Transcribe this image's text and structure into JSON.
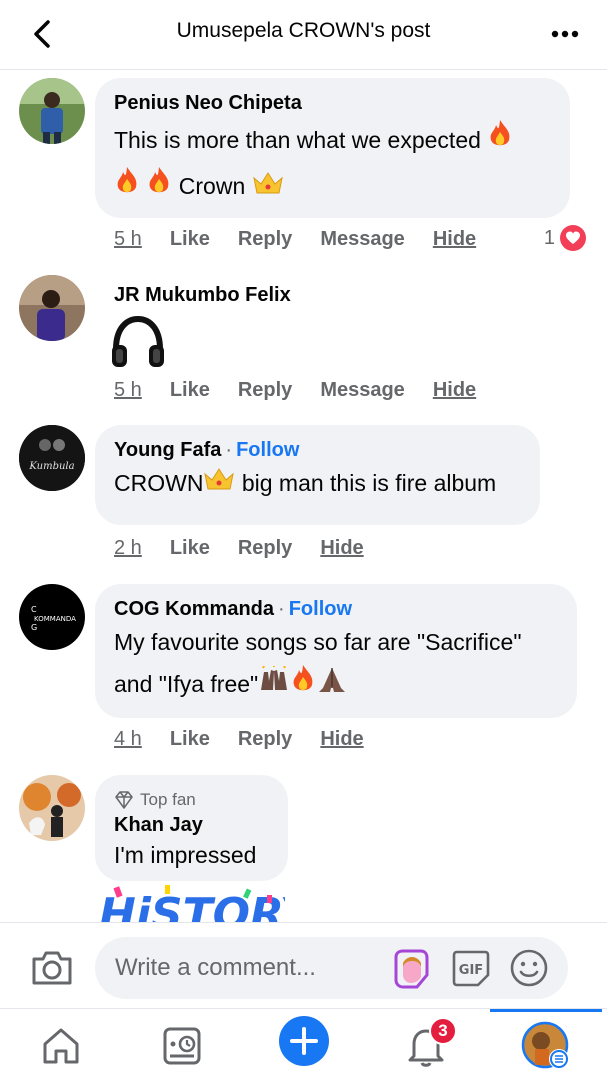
{
  "header": {
    "title": "Umusepela CROWN's post"
  },
  "comments": [
    {
      "author": "Penius Neo Chipeta",
      "text_line1": "This is more than what we expected",
      "text_line2": "Crown",
      "time": "5 h",
      "like": "Like",
      "reply": "Reply",
      "message": "Message",
      "hide": "Hide",
      "reaction_count": "1"
    },
    {
      "author": "JR Mukumbo Felix",
      "time": "5 h",
      "like": "Like",
      "reply": "Reply",
      "message": "Message",
      "hide": "Hide"
    },
    {
      "author": "Young Fafa",
      "follow": "Follow",
      "text_a": "CROWN",
      "text_b": " big man this is fire album",
      "time": "2 h",
      "like": "Like",
      "reply": "Reply",
      "hide": "Hide",
      "avatar_text": "Kumbula"
    },
    {
      "author": "COG Kommanda",
      "follow": "Follow",
      "text_line1": "My favourite songs so far are \"Sacrifice\"",
      "text_line2": "and \"Ifya free\"",
      "time": "4 h",
      "like": "Like",
      "reply": "Reply",
      "hide": "Hide",
      "avatar_text": "KOMMANDA"
    },
    {
      "badge": "Top fan",
      "author": "Khan Jay",
      "text": "I'm impressed",
      "sticker": "HiSTORY"
    }
  ],
  "composer": {
    "placeholder": "Write a comment...",
    "gif_label": "GIF"
  },
  "tabbar": {
    "notifications_badge": "3"
  },
  "colors": {
    "accent": "#1877f2",
    "bubble": "#f0f2f5",
    "secondary_text": "#65676b",
    "badge_red": "#e41e3f"
  }
}
